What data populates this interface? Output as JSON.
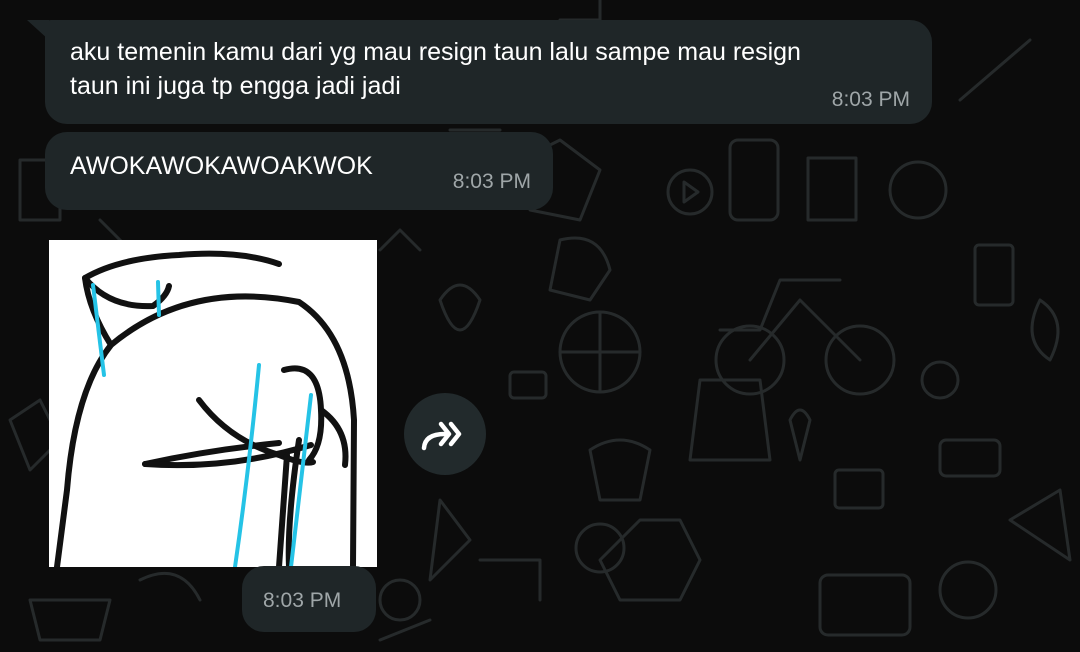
{
  "messages": [
    {
      "text": "aku temenin kamu dari yg mau resign taun lalu sampe mau resign taun ini juga tp engga jadi jadi",
      "time": "8:03 PM"
    },
    {
      "text": "AWOKAWOKAWOAKWOK",
      "time": "8:03 PM"
    }
  ],
  "sticker": {
    "time": "8:03 PM"
  },
  "forward_icon": "double-forward-arrow-icon",
  "colors": {
    "bubble": "#1f2628",
    "background": "#0c0c0c",
    "timestamp": "#9fa6a8",
    "sticker_tears": "#25c3e6"
  }
}
